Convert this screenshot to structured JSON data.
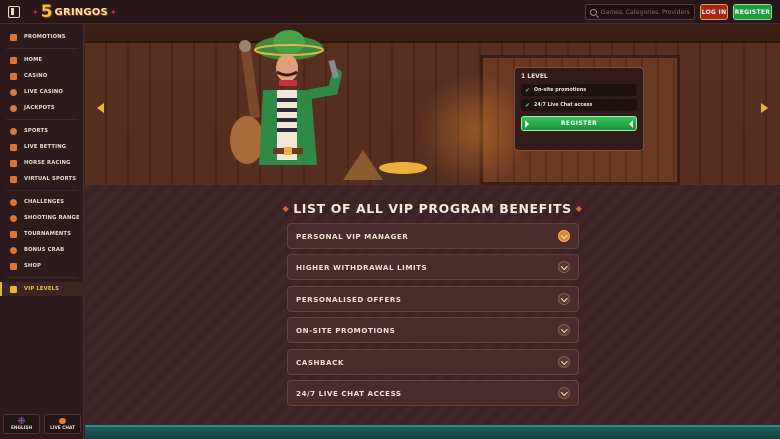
{
  "header": {
    "logo_number": "5",
    "logo_text": "GRINGOS",
    "search_placeholder": "Games, Categories, Providers",
    "login_label": "LOG IN",
    "register_label": "REGISTER"
  },
  "sidebar": {
    "items": [
      {
        "label": "PROMOTIONS",
        "icon": "gift-icon"
      },
      {
        "label": "HOME",
        "icon": "home-icon"
      },
      {
        "label": "CASINO",
        "icon": "cards-icon"
      },
      {
        "label": "LIVE CASINO",
        "icon": "dealer-icon"
      },
      {
        "label": "JACKPOTS",
        "icon": "coins-icon"
      },
      {
        "label": "SPORTS",
        "icon": "ball-icon"
      },
      {
        "label": "LIVE BETTING",
        "icon": "live-icon"
      },
      {
        "label": "HORSE RACING",
        "icon": "horse-icon"
      },
      {
        "label": "VIRTUAL SPORTS",
        "icon": "virtual-icon"
      },
      {
        "label": "CHALLENGES",
        "icon": "target-icon"
      },
      {
        "label": "SHOOTING RANGE",
        "icon": "crosshair-icon"
      },
      {
        "label": "TOURNAMENTS",
        "icon": "trophy-icon"
      },
      {
        "label": "BONUS CRAB",
        "icon": "crab-icon"
      },
      {
        "label": "SHOP",
        "icon": "shop-icon"
      },
      {
        "label": "VIP LEVELS",
        "icon": "crown-icon",
        "active": true
      }
    ],
    "language_label": "ENGLISH",
    "chat_label": "LIVE CHAT"
  },
  "banner": {
    "card_title": "1 LEVEL",
    "features": [
      "On-site promotions",
      "24/7 Live Chat access"
    ],
    "register_label": "REGISTER"
  },
  "main": {
    "title": "LIST OF ALL VIP PROGRAM BENEFITS",
    "benefits": [
      "PERSONAL VIP MANAGER",
      "HIGHER WITHDRAWAL LIMITS",
      "PERSONALISED OFFERS",
      "ON-SITE PROMOTIONS",
      "CASHBACK",
      "24/7 LIVE CHAT ACCESS"
    ]
  },
  "colors": {
    "accent": "#e9b33a",
    "register_green": "#1f9a45",
    "login_red": "#a8241f"
  }
}
